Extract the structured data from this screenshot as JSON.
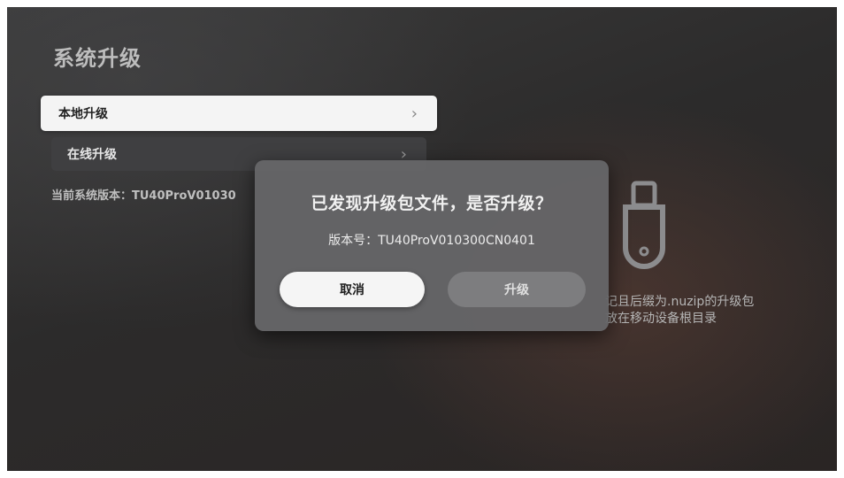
{
  "page": {
    "title": "系统升级"
  },
  "menu": {
    "items": [
      {
        "label": "本地升级",
        "chevron": "›",
        "focused": true
      },
      {
        "label": "在线升级",
        "chevron": "›",
        "focused": false
      }
    ]
  },
  "system": {
    "version_text": "当前系统版本：TU40ProV01030"
  },
  "hint": {
    "icon": "usb-drive-icon",
    "line1": "记且后缀为.nuzip的升级包",
    "line2": "放在移动设备根目录"
  },
  "dialog": {
    "title": "已发现升级包文件，是否升级？",
    "version_text": "版本号：TU40ProV010300CN0401",
    "cancel_label": "取消",
    "confirm_label": "升级"
  },
  "colors": {
    "focused_item_bg": "#f4f4f4",
    "dialog_bg": "#666668",
    "cancel_button_bg": "#f5f5f5",
    "confirm_button_bg": "#7d7d7f"
  }
}
